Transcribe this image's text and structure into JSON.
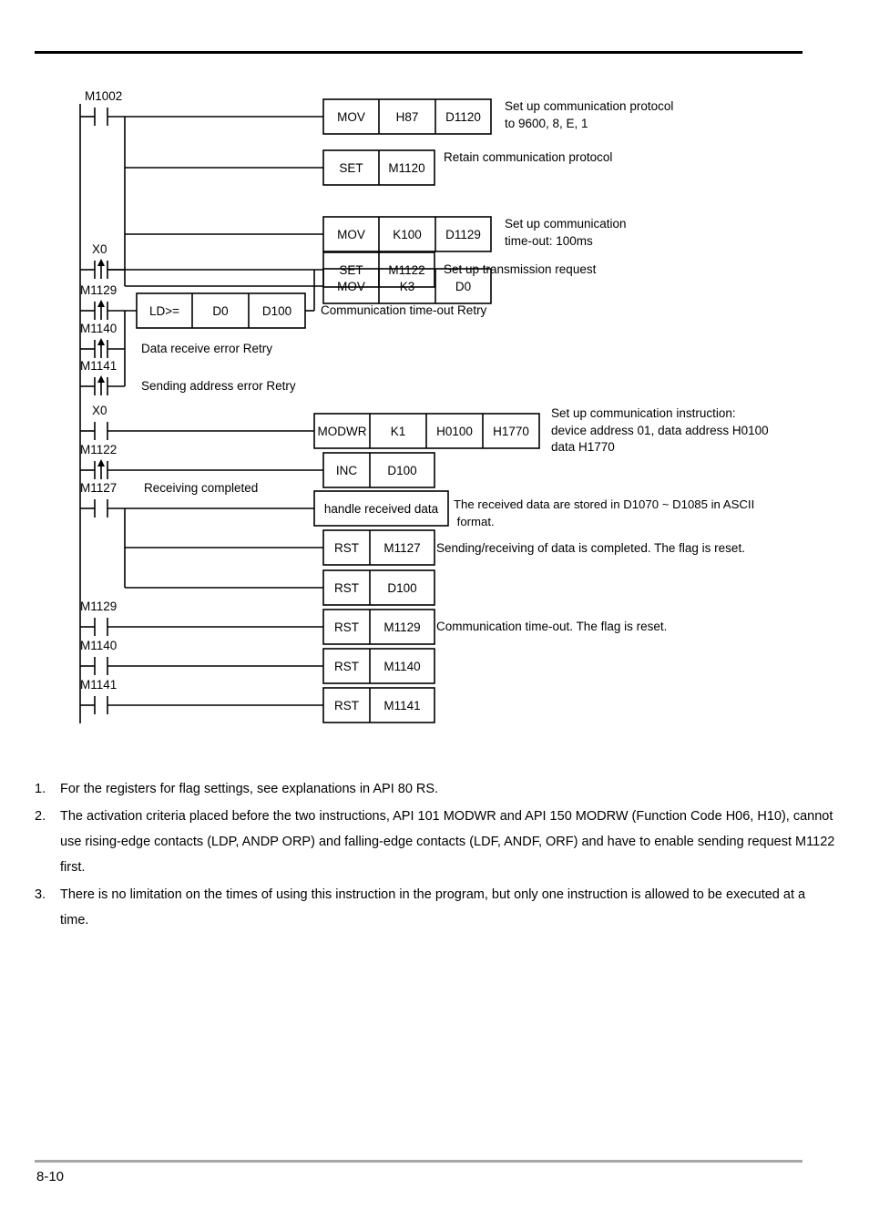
{
  "document": {
    "page_number": "8-10"
  },
  "ladder": {
    "rungs": [
      {
        "id": "rung-m1002",
        "contact": {
          "label": "M1002",
          "type": "normally-open"
        },
        "instructions": [
          {
            "op": "MOV",
            "operands": [
              "H87",
              "D1120"
            ],
            "comment": "Set up communication protocol\nto 9600, 8, E, 1"
          },
          {
            "op": "SET",
            "operands": [
              "M1120"
            ],
            "comment": "Retain communication protocol"
          },
          {
            "op": "MOV",
            "operands": [
              "K100",
              "D1129"
            ],
            "comment": "Set up communication\ntime-out: 100ms"
          },
          {
            "op": "MOV",
            "operands": [
              "K3",
              "D0"
            ],
            "comment": ""
          }
        ]
      },
      {
        "id": "rung-x0-set",
        "contact": {
          "label": "X0",
          "type": "rising-edge"
        },
        "instructions": [
          {
            "op": "SET",
            "operands": [
              "M1122"
            ],
            "comment": "Set up transmission request"
          }
        ]
      },
      {
        "id": "rung-m1129-retry",
        "contact": {
          "label": "M1129",
          "type": "rising-edge"
        },
        "compare": {
          "op": "LD>=",
          "operands": [
            "D0",
            "D100"
          ]
        },
        "comment": "Communication time-out Retry"
      },
      {
        "id": "rung-m1140-retry",
        "contact": {
          "label": "M1140",
          "type": "rising-edge"
        },
        "comment": "Data receive error Retry"
      },
      {
        "id": "rung-m1141-retry",
        "contact": {
          "label": "M1141",
          "type": "rising-edge"
        },
        "comment": "Sending address error Retry"
      },
      {
        "id": "rung-x0-modwr",
        "contact": {
          "label": "X0",
          "type": "normally-open"
        },
        "instructions": [
          {
            "op": "MODWR",
            "operands": [
              "K1",
              "H0100",
              "H1770"
            ],
            "comment": "Set up communication instruction:\ndevice address 01, data address H0100\ndata H1770"
          }
        ]
      },
      {
        "id": "rung-m1122-inc",
        "contact": {
          "label": "M1122",
          "type": "rising-edge"
        },
        "instructions": [
          {
            "op": "INC",
            "operands": [
              "D100"
            ],
            "comment": ""
          }
        ]
      },
      {
        "id": "rung-m1127",
        "contact": {
          "label": "M1127",
          "type": "normally-open"
        },
        "contact_note": "Receiving completed",
        "instructions": [
          {
            "op": "handle received data",
            "operands": [],
            "comment": "The received data are stored in D1070 ~ D1085 in ASCII\n format."
          },
          {
            "op": "RST",
            "operands": [
              "M1127"
            ],
            "comment": "Sending/receiving of data is completed. The flag is reset."
          },
          {
            "op": "RST",
            "operands": [
              "D100"
            ],
            "comment": ""
          }
        ]
      },
      {
        "id": "rung-m1129-rst",
        "contact": {
          "label": "M1129",
          "type": "normally-open"
        },
        "instructions": [
          {
            "op": "RST",
            "operands": [
              "M1129"
            ],
            "comment": "Communication time-out. The flag is reset."
          }
        ]
      },
      {
        "id": "rung-m1140-rst",
        "contact": {
          "label": "M1140",
          "type": "normally-open"
        },
        "instructions": [
          {
            "op": "RST",
            "operands": [
              "M1140"
            ],
            "comment": ""
          }
        ]
      },
      {
        "id": "rung-m1141-rst",
        "contact": {
          "label": "M1141",
          "type": "normally-open"
        },
        "instructions": [
          {
            "op": "RST",
            "operands": [
              "M1141"
            ],
            "comment": ""
          }
        ]
      }
    ],
    "labels": {
      "m1002": "M1002",
      "x0_a": "X0",
      "m1129_a": "M1129",
      "m1140_a": "M1140",
      "m1141_a": "M1141",
      "x0_b": "X0",
      "m1122": "M1122",
      "m1127": "M1127",
      "m1127_note": "Receiving completed",
      "m1129_b": "M1129",
      "m1140_b": "M1140",
      "m1141_b": "M1141"
    },
    "boxes": {
      "b1_op": "MOV",
      "b1_o1": "H87",
      "b1_o2": "D1120",
      "b2_op": "SET",
      "b2_o1": "M1120",
      "b3_op": "MOV",
      "b3_o1": "K100",
      "b3_o2": "D1129",
      "b4_op": "MOV",
      "b4_o1": "K3",
      "b4_o2": "D0",
      "b5_op": "SET",
      "b5_o1": "M1122",
      "b6_op": "LD>=",
      "b6_o1": "D0",
      "b6_o2": "D100",
      "b7_op": "MODWR",
      "b7_o1": "K1",
      "b7_o2": "H0100",
      "b7_o3": "H1770",
      "b8_op": "INC",
      "b8_o1": "D100",
      "b9_op": "handle received data",
      "b10_op": "RST",
      "b10_o1": "M1127",
      "b11_op": "RST",
      "b11_o1": "D100",
      "b12_op": "RST",
      "b12_o1": "M1129",
      "b13_op": "RST",
      "b13_o1": "M1140",
      "b14_op": "RST",
      "b14_o1": "M1141"
    },
    "comments": {
      "c1": "Set up communication protocol\nto 9600, 8, E, 1",
      "c2": "Retain communication protocol",
      "c3": "Set up communication\ntime-out: 100ms",
      "c4": "Set up transmission request",
      "c5": "Communication time-out Retry",
      "c6": "Data receive error Retry",
      "c7": "Sending address error Retry",
      "c8": "Set up communication instruction:\ndevice address 01, data address H0100\ndata H1770",
      "c9": "The received data are stored in D1070 ~ D1085 in ASCII\n format.",
      "c10": "Sending/receiving of data is completed. The flag is reset.",
      "c11": "Communication time-out. The flag is reset."
    }
  },
  "notes": [
    {
      "num": "1.",
      "text": "For the registers for flag settings, see explanations in API 80 RS."
    },
    {
      "num": "2.",
      "text": "The activation criteria placed before the two instructions, API 101 MODWR and API 150 MODRW (Function Code H06, H10), cannot use rising-edge contacts (LDP, ANDP ORP) and falling-edge contacts (LDF, ANDF, ORF) and have to enable sending request M1122 first."
    },
    {
      "num": "3.",
      "text": "There is no limitation on the times of using this instruction in the program, but only one instruction is allowed to be executed at a time."
    }
  ]
}
